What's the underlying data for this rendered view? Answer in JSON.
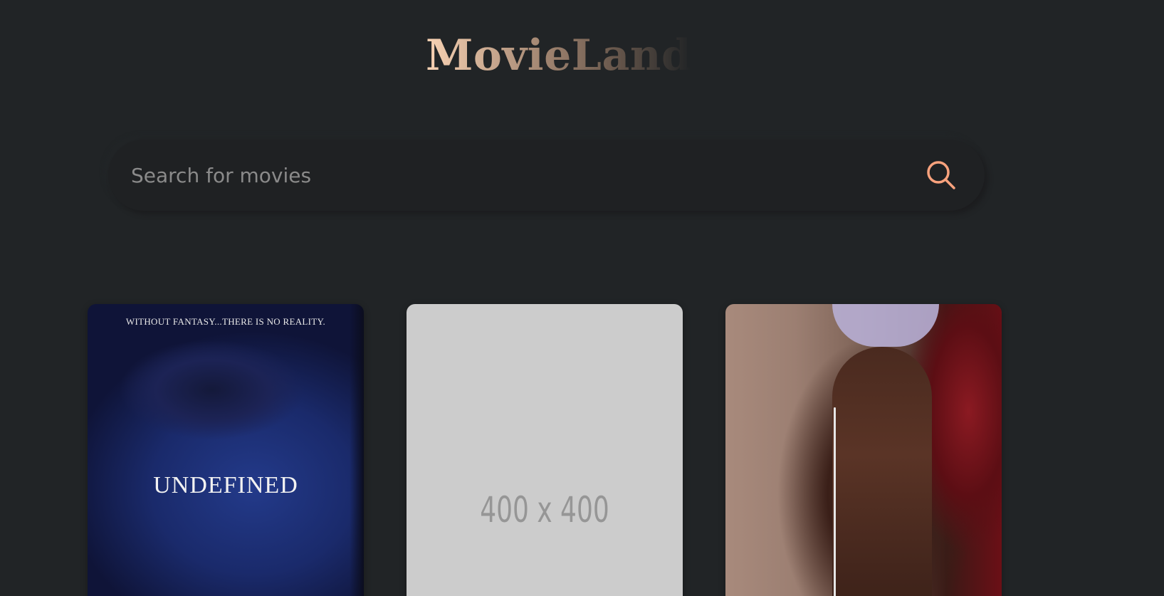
{
  "app": {
    "title": "MovieLand"
  },
  "search": {
    "placeholder": "Search for movies",
    "value": "",
    "icon": "search-icon",
    "icon_color": "#f9a27d"
  },
  "colors": {
    "background": "#212426",
    "search_bg": "#1f2123",
    "title_gradient_start": "#f9d3b4",
    "placeholder_card": "#cccccc"
  },
  "movies": [
    {
      "poster_tagline": "WITHOUT FANTASY...THERE IS NO REALITY.",
      "poster_title": "UNDEFINED"
    },
    {
      "poster_placeholder": "400 x 400"
    },
    {
      "poster_kind": "photo"
    }
  ]
}
